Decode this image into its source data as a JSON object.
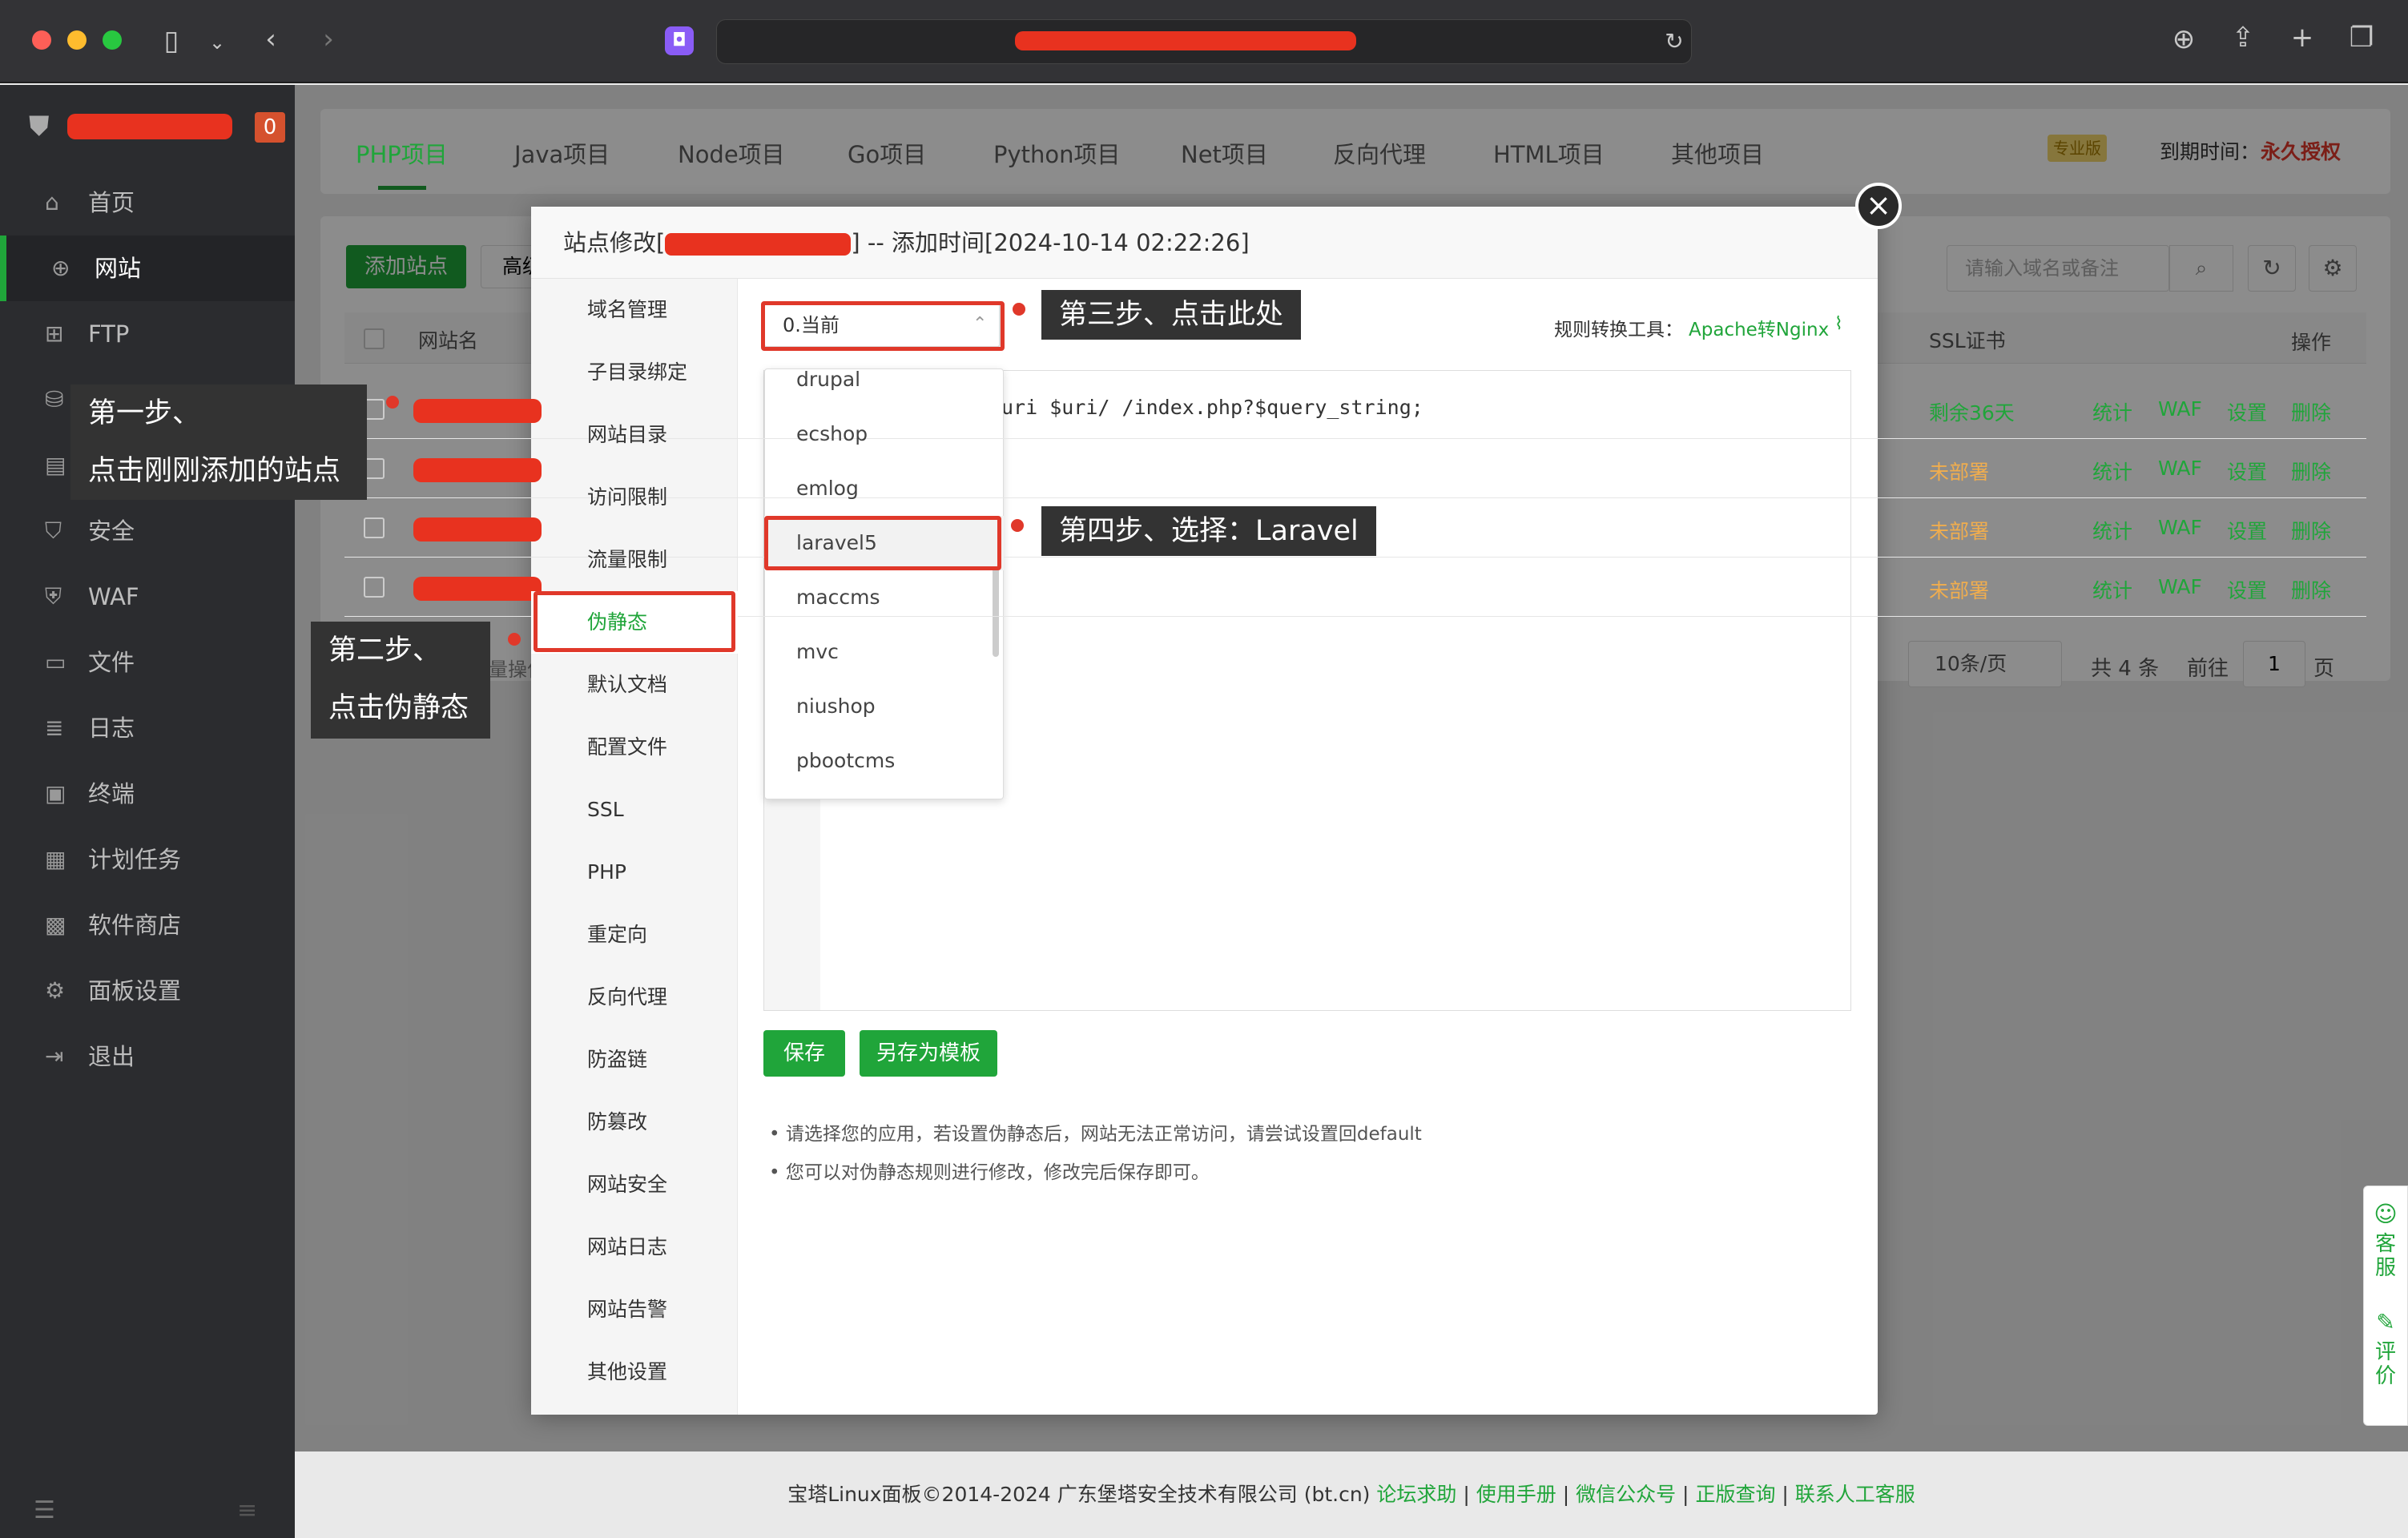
{
  "browser": {
    "tab_icon": "extension-icon"
  },
  "sidebar": {
    "badge": "0",
    "items": [
      {
        "label": "首页",
        "icon": "home-icon"
      },
      {
        "label": "网站",
        "icon": "globe-icon"
      },
      {
        "label": "FTP",
        "icon": "ftp-icon"
      },
      {
        "label": "数据库",
        "icon": "database-icon"
      },
      {
        "label": "监控",
        "icon": "monitor-icon"
      },
      {
        "label": "安全",
        "icon": "shield-icon"
      },
      {
        "label": "WAF",
        "icon": "waf-icon"
      },
      {
        "label": "文件",
        "icon": "folder-icon"
      },
      {
        "label": "日志",
        "icon": "log-icon"
      },
      {
        "label": "终端",
        "icon": "terminal-icon"
      },
      {
        "label": "计划任务",
        "icon": "calendar-icon"
      },
      {
        "label": "软件商店",
        "icon": "store-icon"
      },
      {
        "label": "面板设置",
        "icon": "gear-icon"
      },
      {
        "label": "退出",
        "icon": "logout-icon"
      }
    ]
  },
  "project_tabs": [
    "PHP项目",
    "Java项目",
    "Node项目",
    "Go项目",
    "Python项目",
    "Net项目",
    "反向代理",
    "HTML项目",
    "其他项目"
  ],
  "license": {
    "edition": "专业版",
    "expiry_label": "到期时间：",
    "expiry_value": "永久授权"
  },
  "site_list": {
    "add_button": "添加站点",
    "advanced_button": "高级",
    "search_placeholder": "请输入域名或备注",
    "col_name": "网站名",
    "col_ssl": "SSL证书",
    "col_ops": "操作",
    "batch": "请选择批量操作",
    "rows": [
      {
        "ssl": "剩余36天",
        "ssl_color": "#20a53a"
      },
      {
        "ssl": "未部署",
        "ssl_color": "#f0ad4e"
      },
      {
        "ssl": "未部署",
        "ssl_color": "#f0ad4e"
      },
      {
        "ssl": "未部署",
        "ssl_color": "#f0ad4e"
      }
    ],
    "ops": [
      "统计",
      "WAF",
      "设置",
      "删除"
    ],
    "pagination": {
      "per_page": "10条/页",
      "total": "共 4 条",
      "goto": "前往",
      "page": "1",
      "page_suffix": "页"
    }
  },
  "modal": {
    "title_prefix": "站点修改[",
    "title_suffix": "] -- 添加时间[2024-10-14 02:22:26]",
    "nav": [
      "域名管理",
      "子目录绑定",
      "网站目录",
      "访问限制",
      "流量限制",
      "伪静态",
      "默认文档",
      "配置文件",
      "SSL",
      "PHP",
      "重定向",
      "反向代理",
      "防盗链",
      "防篡改",
      "网站安全",
      "网站日志",
      "网站告警",
      "其他设置"
    ],
    "active_nav": "伪静态",
    "select_value": "0.当前",
    "tool_label": "规则转换工具：",
    "tool_link": "Apache转Nginx",
    "code_line": "uri $uri/ /index.php?$query_string;",
    "dropdown": [
      "drupal",
      "ecshop",
      "emlog",
      "laravel5",
      "maccms",
      "mvc",
      "niushop",
      "pbootcms"
    ],
    "save_button": "保存",
    "save_template_button": "另存为模板",
    "tips": [
      "请选择您的应用，若设置伪静态后，网站无法正常访问，请尝试设置回default",
      "您可以对伪静态规则进行修改，修改完后保存即可。"
    ]
  },
  "annotations": {
    "step1_line1": "第一步、",
    "step1_line2": "点击刚刚添加的站点",
    "step2_line1": "第二步、",
    "step2_line2": "点击伪静态",
    "step3": "第三步、点击此处",
    "step4": "第四步、选择：Laravel"
  },
  "footer": {
    "copyright": "宝塔Linux面板©2014-2024 广东堡塔安全技术有限公司 (bt.cn)",
    "links": [
      "论坛求助",
      "使用手册",
      "微信公众号",
      "正版查询",
      "联系人工客服"
    ]
  },
  "helper": {
    "service": "客服",
    "feedback": "评价"
  }
}
